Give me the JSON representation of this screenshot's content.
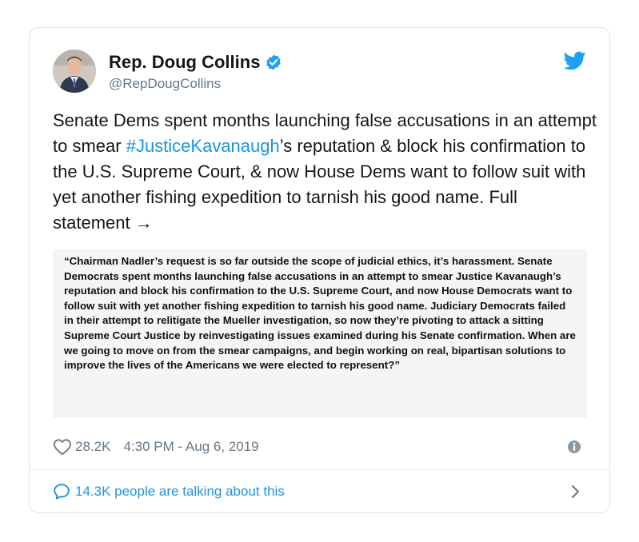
{
  "tweet": {
    "author": {
      "display_name": "Rep. Doug Collins",
      "handle": "@RepDougCollins",
      "avatar_icon": "profile-photo",
      "verified_icon": "verified-badge-icon"
    },
    "text": {
      "part1": "Senate Dems spent months launching false accusations in an attempt to smear ",
      "hashtag": "#JusticeKavanaugh",
      "part2": "’s reputation & block his confirmation to the U.S. Supreme Court, & now House Dems want to follow suit with yet another fishing expedition to tarnish his good name. Full statement →"
    },
    "statement_image_text": "“Chairman Nadler’s request is so far outside the scope of judicial ethics, it’s harassment. Senate Democrats spent months launching false accusations in an attempt to smear Justice Kavanaugh’s reputation and block his confirmation to the U.S. Supreme Court, and now House Democrats want to follow suit with yet another fishing expedition to tarnish his good name. Judiciary Democrats failed in their attempt to relitigate the Mueller investigation, so now they’re pivoting to attack a sitting Supreme Court Justice by reinvestigating issues examined during his Senate confirmation. When are we going to move on from the smear campaigns, and begin working on real, bipartisan solutions to improve the lives of the Americans we were elected to represent?”",
    "likes": "28.2K",
    "timestamp": "4:30 PM - Aug 6, 2019",
    "talking": "14.3K people are talking about this"
  },
  "colors": {
    "brand": "#1da1f2",
    "link": "#1b95e0",
    "muted": "#657786",
    "text": "#14171a"
  },
  "icons": {
    "brand": "twitter-bird-icon",
    "like": "heart-icon",
    "info": "info-icon",
    "reply": "speech-bubble-icon",
    "chevron": "chevron-right-icon"
  }
}
